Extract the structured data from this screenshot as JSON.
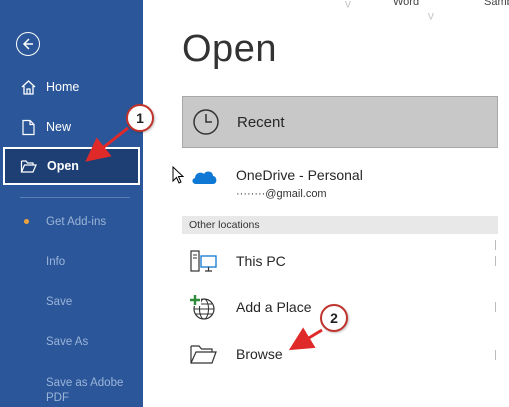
{
  "header": {
    "word_label": "Word",
    "user_label": "Samb"
  },
  "sidebar": {
    "items": [
      {
        "label": "Home",
        "icon": "home-icon"
      },
      {
        "label": "New",
        "icon": "new-document-icon"
      },
      {
        "label": "Open",
        "icon": "folder-open-icon",
        "selected": true
      },
      {
        "label": "Get Add-ins"
      },
      {
        "label": "Info"
      },
      {
        "label": "Save"
      },
      {
        "label": "Save As"
      },
      {
        "label": "Save as Adobe PDF"
      }
    ]
  },
  "main": {
    "title": "Open",
    "recent_label": "Recent",
    "onedrive_label": "OneDrive - Personal",
    "onedrive_account": "········@gmail.com",
    "other_locations_header": "Other locations",
    "this_pc_label": "This PC",
    "add_place_label": "Add a Place",
    "browse_label": "Browse"
  },
  "annotations": {
    "step1": "1",
    "step2": "2",
    "color": "#e02a2a"
  },
  "colors": {
    "sidebar_bg": "#2b579a",
    "selected_bg": "#1d3f74",
    "recent_bg": "#c8c8c8",
    "onedrive_blue": "#0f78d4"
  }
}
